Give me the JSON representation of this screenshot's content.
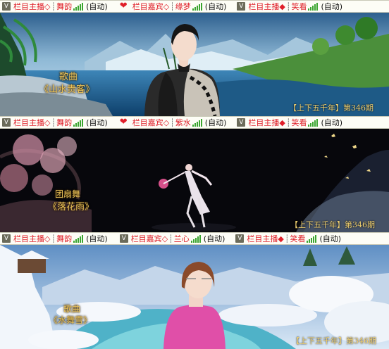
{
  "bars": [
    {
      "segments": [
        {
          "icon": "v-logo-icon",
          "role": "栏目主播",
          "diamond": "◇",
          "sep": "┊",
          "name": "舞韵",
          "auto": "(自动)"
        },
        {
          "icon": "heart-icon",
          "role": "栏目嘉宾",
          "diamond": "◇",
          "sep": "┊",
          "name": "缘梦",
          "auto": "(自动)"
        },
        {
          "icon": "v-logo-icon",
          "role": "栏目主播",
          "diamond": "◆",
          "sep": "┊",
          "name": "笑看",
          "auto": "(自动)"
        }
      ]
    },
    {
      "segments": [
        {
          "icon": "v-logo-icon",
          "role": "栏目主播",
          "diamond": "◇",
          "sep": "┊",
          "name": "舞韵",
          "auto": "(自动)"
        },
        {
          "icon": "heart-icon",
          "role": "栏目嘉宾",
          "diamond": "◇",
          "sep": "┊",
          "name": "紫水",
          "auto": "(自动)"
        },
        {
          "icon": "v-logo-icon",
          "role": "栏目主播",
          "diamond": "◆",
          "sep": "┊",
          "name": "笑看",
          "auto": "(自动)"
        }
      ]
    },
    {
      "segments": [
        {
          "icon": "v-logo-icon",
          "role": "栏目主播",
          "diamond": "◇",
          "sep": "┊",
          "name": "舞韵",
          "auto": "(自动)"
        },
        {
          "icon": "v-logo-icon",
          "role": "栏目嘉宾",
          "diamond": "◇",
          "sep": "┊",
          "name": "兰心",
          "auto": "(自动)"
        },
        {
          "icon": "v-logo-icon",
          "role": "栏目主播",
          "diamond": "◆",
          "sep": "┊",
          "name": "笑看",
          "auto": "(自动)"
        }
      ]
    }
  ],
  "panels": [
    {
      "label": "歌曲",
      "title": "《山水贵客》",
      "episode": "【上下五千年】第346期"
    },
    {
      "label": "团扇舞",
      "title": "《落花雨》",
      "episode": "【上下五千年】第346期"
    },
    {
      "label": "歌曲",
      "title": "《水舞雪》",
      "episode": "【上下五千年】第346期"
    }
  ]
}
